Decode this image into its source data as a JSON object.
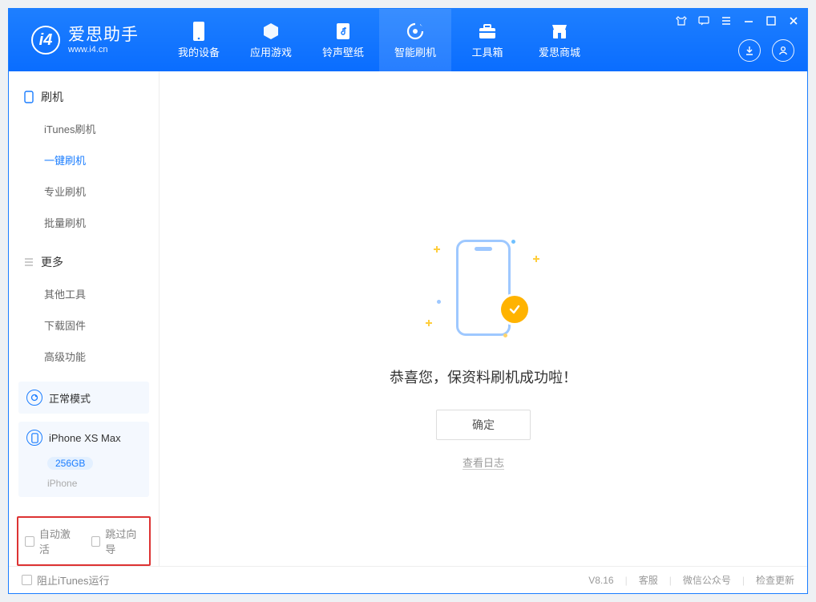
{
  "header": {
    "app_name": "爱思助手",
    "app_url": "www.i4.cn",
    "tabs": [
      {
        "label": "我的设备",
        "icon": "device-icon"
      },
      {
        "label": "应用游戏",
        "icon": "cube-icon"
      },
      {
        "label": "铃声壁纸",
        "icon": "music-icon"
      },
      {
        "label": "智能刷机",
        "icon": "flash-icon",
        "active": true
      },
      {
        "label": "工具箱",
        "icon": "toolbox-icon"
      },
      {
        "label": "爱思商城",
        "icon": "store-icon"
      }
    ]
  },
  "sidebar": {
    "groups": [
      {
        "title": "刷机",
        "items": [
          "iTunes刷机",
          "一键刷机",
          "专业刷机",
          "批量刷机"
        ],
        "active_index": 1,
        "icon": "phone-flash-icon"
      },
      {
        "title": "更多",
        "items": [
          "其他工具",
          "下载固件",
          "高级功能"
        ],
        "icon": "menu-icon"
      }
    ],
    "mode_panel": "正常模式",
    "device": {
      "name": "iPhone XS Max",
      "capacity": "256GB",
      "type": "iPhone"
    },
    "options": {
      "auto_activate": "自动激活",
      "skip_guide": "跳过向导"
    }
  },
  "main": {
    "message": "恭喜您，保资料刷机成功啦！",
    "confirm_label": "确定",
    "log_link": "查看日志"
  },
  "footer": {
    "block_itunes": "阻止iTunes运行",
    "version": "V8.16",
    "links": [
      "客服",
      "微信公众号",
      "检查更新"
    ]
  }
}
